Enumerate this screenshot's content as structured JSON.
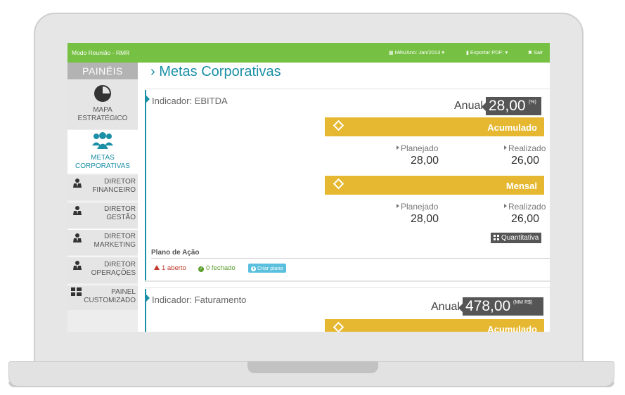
{
  "app": {
    "title": "Modo Reunião - RMR"
  },
  "topbar": {
    "period_icon": "calendar-icon",
    "period_label": "Mês/Ano: Jan/2013 ▾",
    "export_icon": "file-icon",
    "export_label": "Exportar PDF: ▾",
    "exit_icon": "close-icon",
    "exit_label": "Sair",
    "color": "#76c043"
  },
  "sidebar": {
    "header": "PAINÉIS",
    "items": [
      {
        "line1": "MAPA",
        "line2": "ESTRATÉGICO",
        "icon": "pie-chart-icon"
      },
      {
        "line1": "METAS",
        "line2": "CORPORATIVAS",
        "icon": "users-icon",
        "active": true
      },
      {
        "line1": "DIRETOR",
        "line2": "FINANCEIRO",
        "icon": "user-suit-icon"
      },
      {
        "line1": "DIRETOR",
        "line2": "GESTÃO",
        "icon": "user-suit-icon"
      },
      {
        "line1": "DIRETOR",
        "line2": "MARKETING",
        "icon": "user-suit-icon"
      },
      {
        "line1": "DIRETOR",
        "line2": "OPERAÇÕES",
        "icon": "user-suit-icon"
      },
      {
        "line1": "PAINEL",
        "line2": "CUSTOMIZADO",
        "icon": "dashboard-grid-icon"
      }
    ]
  },
  "main": {
    "title": "› Metas Corporativas",
    "indicators": [
      {
        "label": "Indicador: EBITDA",
        "anual_label": "Anual",
        "anual_value": "28,00",
        "anual_unit": "(%)",
        "sections": [
          {
            "label": "Acumulado",
            "planejado_label": "Planejado",
            "planejado": "28,00",
            "realizado_label": "Realizado",
            "realizado": "26,00"
          },
          {
            "label": "Mensal",
            "planejado_label": "Planejado",
            "planejado": "28,00",
            "realizado_label": "Realizado",
            "realizado": "26,00"
          }
        ],
        "badge": "Quantitativa",
        "plano": {
          "title": "Plano de Ação",
          "aberto": "1 aberto",
          "fechado": "0 fechado",
          "criar": "Criar plano",
          "add": "+"
        }
      },
      {
        "label": "Indicador: Faturamento",
        "anual_label": "Anual",
        "anual_value": "478,00",
        "anual_unit": "(MM R$)",
        "sections": [
          {
            "label": "Acumulado"
          }
        ]
      }
    ]
  },
  "colors": {
    "accent": "#1a8fa6",
    "gold": "#e6b832",
    "dark_badge": "#555555"
  }
}
